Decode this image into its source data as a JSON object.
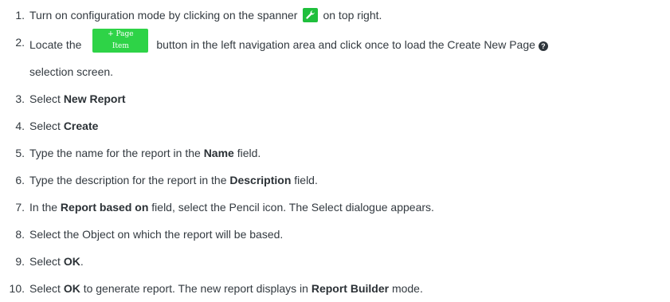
{
  "steps": [
    {
      "num": "1.",
      "before": "Turn on configuration mode by clicking on the spanner",
      "icon": "wrench-icon",
      "after": "on top right."
    },
    {
      "num": "2.",
      "before": "Locate the",
      "button_label": "+ Page Item",
      "mid": "button  in the left navigation area and click once to load the Create New Page",
      "help_icon": "question-circle-icon",
      "help_glyph": "?",
      "after": "selection screen."
    },
    {
      "num": "3.",
      "before": "Select ",
      "bold": "New Report",
      "after": ""
    },
    {
      "num": "4.",
      "before": "Select ",
      "bold": "Create",
      "after": ""
    },
    {
      "num": "5.",
      "before": "Type the name for the report in the ",
      "bold": "Name",
      "after": " field."
    },
    {
      "num": "6.",
      "before": "Type the description for the report in the ",
      "bold": "Description",
      "after": " field."
    },
    {
      "num": "7.",
      "before": "In the ",
      "bold": "Report based on",
      "after": " field, select the Pencil icon. The Select dialogue appears."
    },
    {
      "num": "8.",
      "before": "Select the Object on which the report will be based.",
      "bold": "",
      "after": ""
    },
    {
      "num": "9.",
      "before": "Select ",
      "bold": "OK",
      "after": "."
    },
    {
      "num": "10.",
      "before": "Select ",
      "bold": "OK",
      "mid": " to generate report. The new report displays in ",
      "bold2": "Report Builder",
      "after": " mode."
    }
  ],
  "colors": {
    "text": "#333a40",
    "accent_green": "#2ed347",
    "spanner_green": "#1fbf3c"
  }
}
